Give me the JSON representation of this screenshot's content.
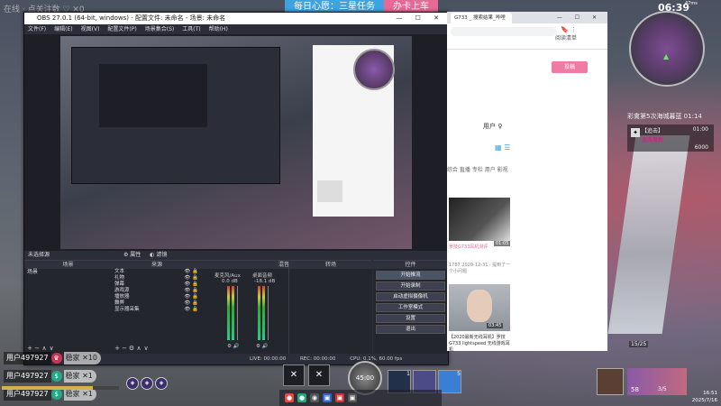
{
  "banner": {
    "daily": "每日心愿：三星任务",
    "card": "办卡上车"
  },
  "game_topleft": "在线 · 点关注数 ♡ ✕0",
  "obs": {
    "title": "OBS 27.0.1 (64-bit, windows) - 配置文件: 未命名 - 场景: 未命名",
    "window_controls": "— ☐ ✕",
    "menu": [
      "文件(F)",
      "编辑(E)",
      "视图(V)",
      "配置文件(P)",
      "场景集合(S)",
      "工具(T)",
      "帮助(H)"
    ],
    "scene_bar_label": "未选择源",
    "scene_bar_props": "属性",
    "scene_bar_filters": "滤镜",
    "panels": {
      "scenes": "场景",
      "sources": "来源",
      "mixer": "混音器",
      "transitions": "转场",
      "controls": "控件"
    },
    "scene_items": [
      "场景"
    ],
    "sources": [
      "文本",
      "礼物",
      "弹幕",
      "游戏源",
      "播放器",
      "舞弊",
      "显示器采集"
    ],
    "mixer": {
      "ch1_label": "麦克风/Aux",
      "ch1_db": "0.0 dB",
      "ch2_label": "桌面音频",
      "ch2_db": "-18.1 dB"
    },
    "controls": [
      "开始推流",
      "开始录制",
      "启动虚拟摄像机",
      "工作室模式",
      "设置",
      "退出"
    ],
    "status": {
      "live": "LIVE: 00:00:00",
      "rec": "REC: 00:00:00",
      "cpu": "CPU: 0.1%, 60.00 fps"
    }
  },
  "browser": {
    "tab": "G733 _ 搜索结果_哔哩",
    "ext_label": "阅读清单",
    "signup": "投稿",
    "user": "用户 ♀",
    "grid_icon": "▦ ☰",
    "filter_tabs": "综合  直播  专栏  用户  影视",
    "card1_time": "01:05",
    "card1_title": "罗技G733耳机测评",
    "card1_meta": "1787  2020-12-31 · 提到了一个小问题",
    "card2_time": "03:45",
    "card2_title": "【2020最新无线耳机】罗技G733 lightspeed 无线游戏耳机"
  },
  "hud": {
    "clock": "06:39",
    "battery": "47ms",
    "zone": "彩禽第5次海城暮蓝 01:14",
    "event_tag": "【追击】",
    "event_time": "01:00",
    "event_sub": "追击鬼新",
    "event_score": "6000",
    "badge": "15/25"
  },
  "chats": [
    {
      "user": "用户497927",
      "gift": "稳家 ✕10"
    },
    {
      "user": "用户497927",
      "gift": "稳家 ✕1"
    },
    {
      "user": "用户497927",
      "gift": "稳家 ✕1"
    }
  ],
  "skills": {
    "center": "45:00",
    "item1": "1",
    "item2": "5"
  },
  "tray": {
    "time": "16:51",
    "date": "2025/7/16"
  },
  "bottom_right": {
    "num": "58",
    "frac": "3/5"
  },
  "hp": 0.78
}
